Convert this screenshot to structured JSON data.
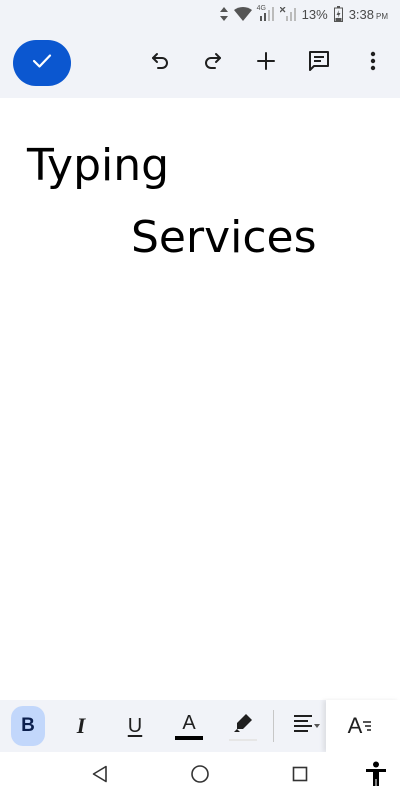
{
  "status": {
    "battery_percent": "13%",
    "time": "3:38",
    "ampm": "PM",
    "network_label": "4G"
  },
  "toolbar": {
    "done_icon": "check-icon",
    "undo_icon": "undo-icon",
    "redo_icon": "redo-icon",
    "insert_icon": "plus-icon",
    "comment_icon": "comment-icon",
    "more_icon": "more-vertical-icon"
  },
  "document": {
    "lines": [
      "Typing",
      "Services"
    ]
  },
  "format_bar": {
    "bold_label": "B",
    "italic_label": "I",
    "underline_label": "U",
    "text_color_label": "A",
    "text_style_label": "A",
    "bold_active": true
  },
  "nav": {
    "back_icon": "back-triangle-icon",
    "home_icon": "home-circle-icon",
    "recents_icon": "recents-square-icon",
    "accessibility_icon": "accessibility-icon"
  },
  "colors": {
    "accent": "#0b57d0",
    "bold_active_bg": "#c2d7fb",
    "toolbar_bg": "#f1f3f8",
    "icon": "#1f1f1f"
  }
}
